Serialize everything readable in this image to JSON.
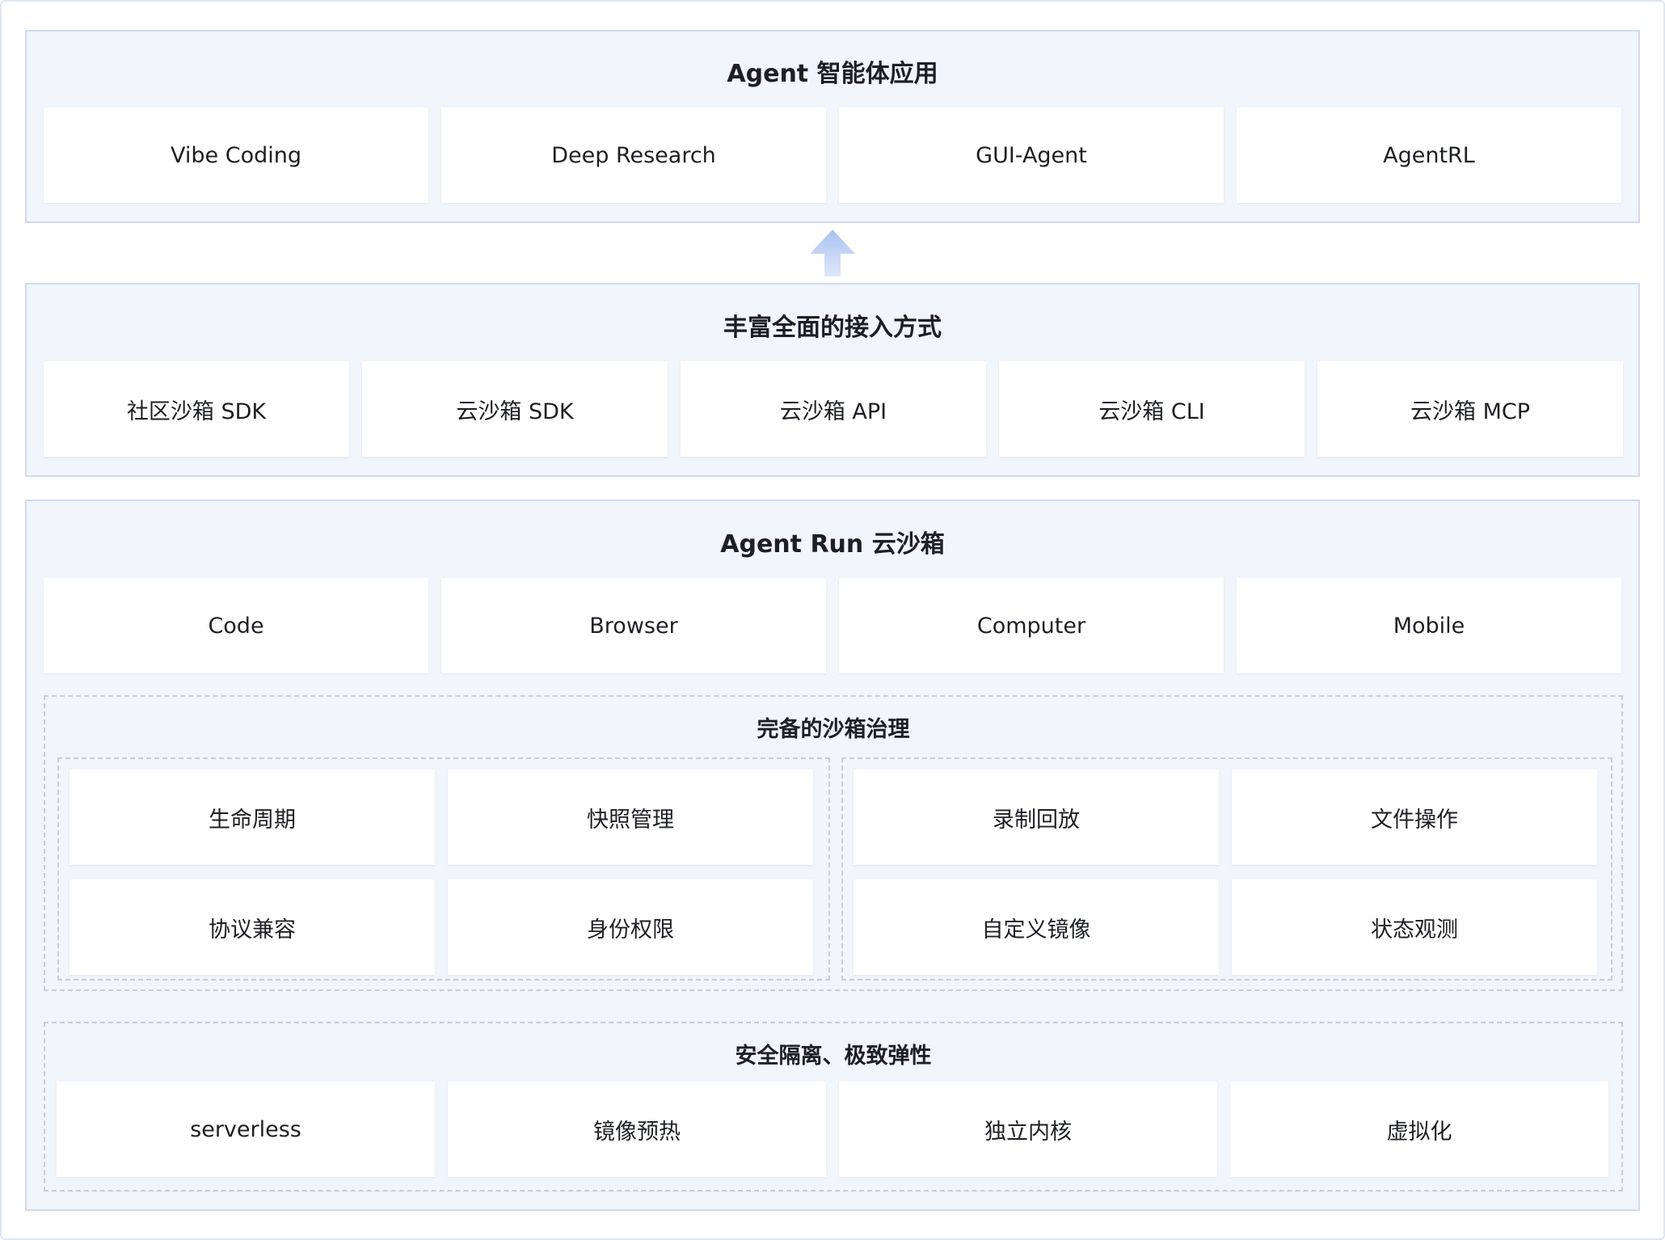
{
  "layers": {
    "apps": {
      "title": "Agent 智能体应用",
      "items": [
        "Vibe Coding",
        "Deep Research",
        "GUI-Agent",
        "AgentRL"
      ]
    },
    "access": {
      "title": "丰富全面的接入方式",
      "items": [
        "社区沙箱 SDK",
        "云沙箱 SDK",
        "云沙箱 API",
        "云沙箱 CLI",
        "云沙箱 MCP"
      ]
    },
    "runtime": {
      "title": "Agent Run 云沙箱",
      "items": [
        "Code",
        "Browser",
        "Computer",
        "Mobile"
      ],
      "governance": {
        "title": "完备的沙箱治理",
        "left": [
          "生命周期",
          "快照管理",
          "协议兼容",
          "身份权限"
        ],
        "right": [
          "录制回放",
          "文件操作",
          "自定义镜像",
          "状态观测"
        ]
      },
      "security": {
        "title": "安全隔离、极致弹性",
        "items": [
          "serverless",
          "镜像预热",
          "独立内核",
          "虚拟化"
        ]
      }
    }
  },
  "colors": {
    "panel_bg": "#f1f5fc",
    "panel_border": "#cfdbee",
    "dashed_border": "#c5cfde",
    "arrow": "#b9cdf3"
  },
  "icons": {
    "flow_arrow": "up-arrow-icon"
  }
}
